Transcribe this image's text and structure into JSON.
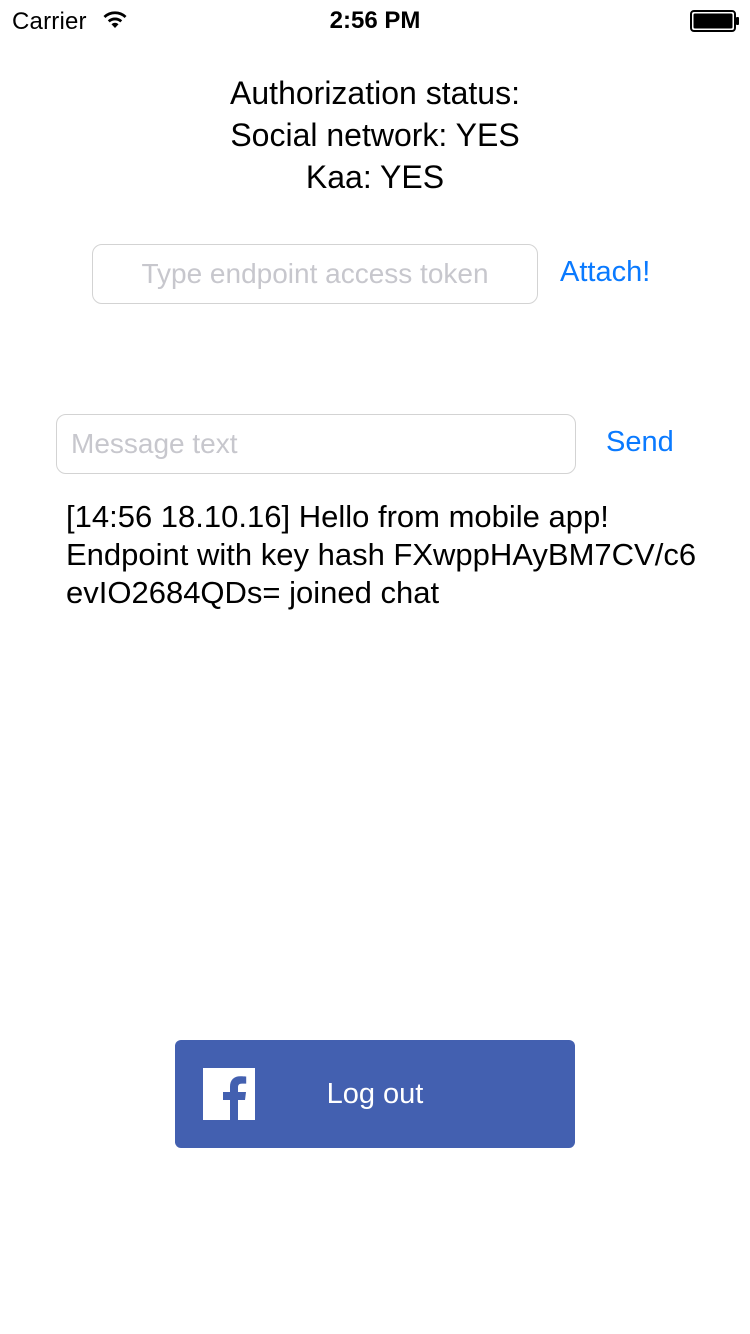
{
  "status_bar": {
    "carrier": "Carrier",
    "time": "2:56 PM",
    "wifi_icon": "wifi-icon",
    "battery_icon": "battery-full-icon"
  },
  "auth": {
    "line1": "Authorization status:",
    "line2": "Social network: YES",
    "line3": "Kaa: YES"
  },
  "token_input": {
    "placeholder": "Type endpoint access token",
    "value": ""
  },
  "attach_button": {
    "label": "Attach!"
  },
  "message_input": {
    "placeholder": "Message text",
    "value": ""
  },
  "send_button": {
    "label": "Send"
  },
  "chat": {
    "lines": [
      "[14:56 18.10.16] Hello from mobile app!",
      "Endpoint with key hash FXwppHAyBM7CV/c6evIO2684QDs= joined chat"
    ]
  },
  "facebook_button": {
    "label": "Log out",
    "icon": "facebook-logo-icon",
    "color": "#4360b0"
  },
  "colors": {
    "accent": "#0a7aff",
    "placeholder": "#c7c7cd",
    "field_border": "#d3d3d3"
  }
}
